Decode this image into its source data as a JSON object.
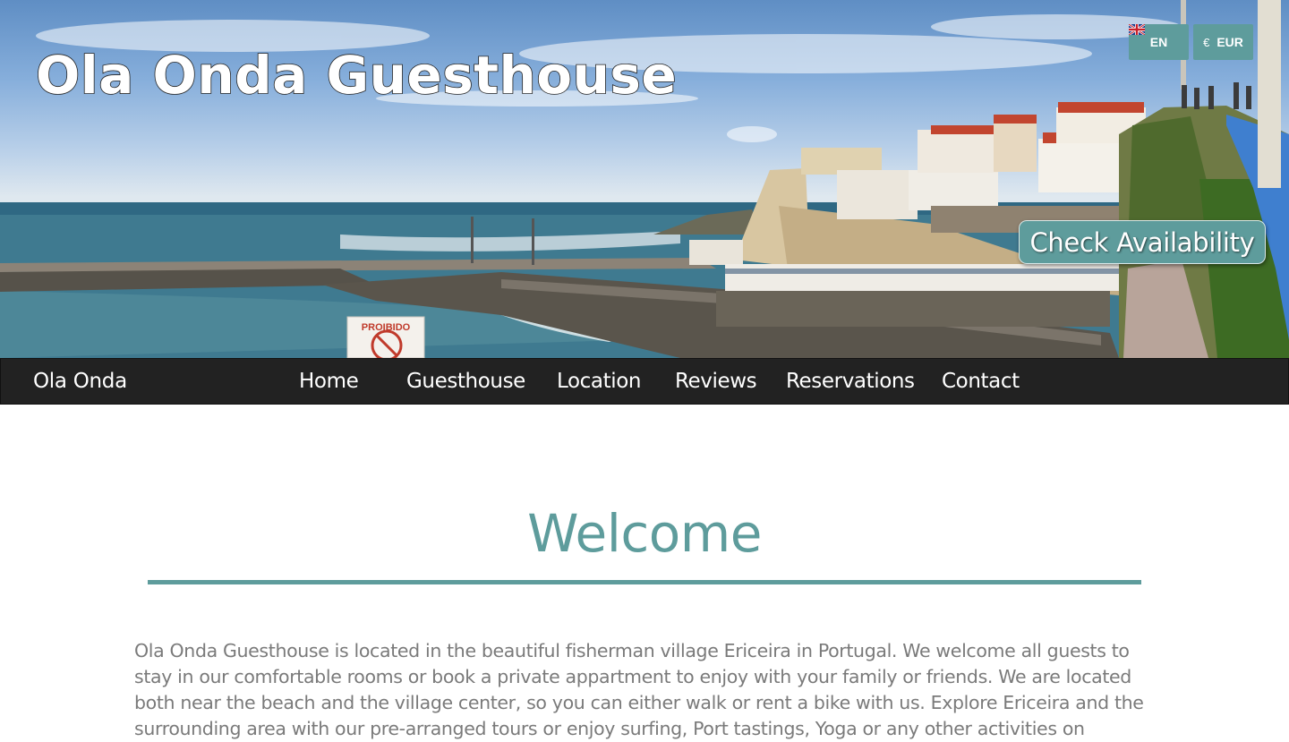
{
  "header": {
    "site_title": "Ola Onda Guesthouse",
    "language": {
      "code": "EN",
      "icon": "uk-flag-icon"
    },
    "currency": {
      "symbol": "€",
      "code": "EUR"
    },
    "check_availability_label": "Check Availability",
    "hero_sign_text": "PROIBIDO"
  },
  "nav": {
    "brand": "Ola Onda",
    "items": [
      {
        "label": "Home"
      },
      {
        "label": "Guesthouse"
      },
      {
        "label": "Location"
      },
      {
        "label": "Reviews"
      },
      {
        "label": "Reservations"
      },
      {
        "label": "Contact"
      }
    ]
  },
  "main": {
    "heading": "Welcome",
    "intro": "Ola Onda Guesthouse is located in the beautiful fisherman village Ericeira in Portugal. We welcome all guests to stay in our comfortable rooms or book a private appartment to enjoy with your family or friends. We are located both near the beach and the village center, so you can either walk or rent a bike with us. Explore Ericeira and the surrounding area with our pre-arranged tours or enjoy surfing, Port tastings, Yoga or any other activities on"
  },
  "colors": {
    "accent": "#5e9c9c",
    "nav_background": "#222222",
    "body_text": "#7a7a7a"
  }
}
